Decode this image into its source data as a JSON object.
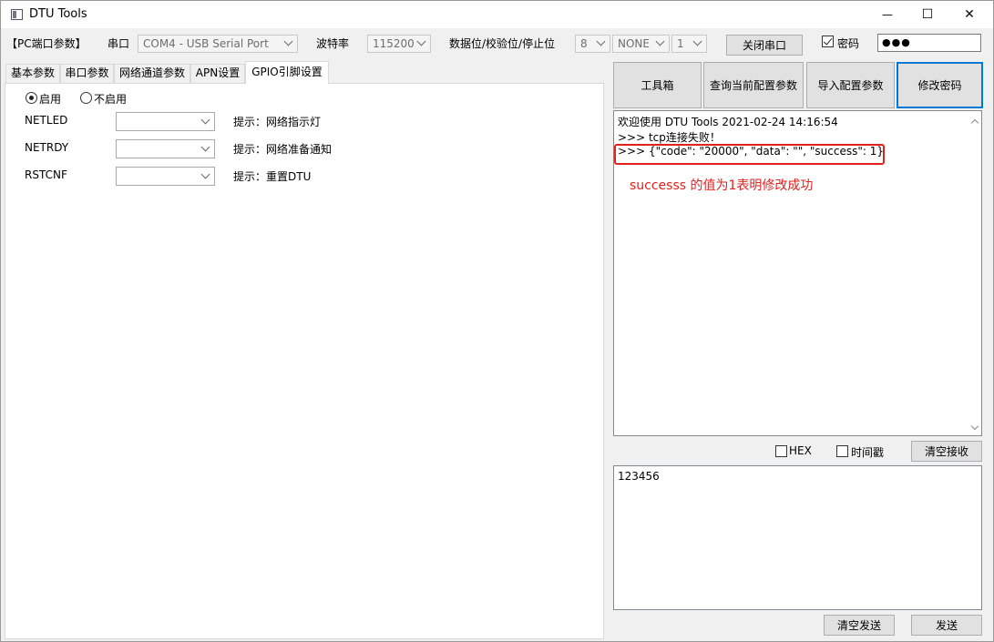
{
  "window": {
    "title": "DTU Tools",
    "minimize_glyph": "—",
    "maximize_glyph": "☐",
    "close_glyph": "✕"
  },
  "toolbar": {
    "pc_port_label": "【PC端口参数】",
    "serial_label": "串口",
    "serial_value": "COM4 - USB Serial Port",
    "baud_label": "波特率",
    "baud_value": "115200",
    "frame_label": "数据位/校验位/停止位",
    "data_bits": "8",
    "parity": "NONE",
    "stop_bits": "1",
    "close_port_button": "关闭串口",
    "password_check_label": "密码",
    "password_checked": true,
    "password_value": "●●●"
  },
  "tabs": [
    {
      "label": "基本参数",
      "active": false
    },
    {
      "label": "串口参数",
      "active": false
    },
    {
      "label": "网络通道参数",
      "active": false
    },
    {
      "label": "APN设置",
      "active": false
    },
    {
      "label": "GPIO引脚设置",
      "active": true
    }
  ],
  "gpio": {
    "enable_label": "启用",
    "disable_label": "不启用",
    "enabled": true,
    "rows": [
      {
        "name": "NETLED",
        "value": "",
        "hint": "提示：网络指示灯"
      },
      {
        "name": "NETRDY",
        "value": "",
        "hint": "提示：网络准备通知"
      },
      {
        "name": "RSTCNF",
        "value": "",
        "hint": "提示：重置DTU"
      }
    ]
  },
  "actions": {
    "toolbox": "工具箱",
    "query_config": "查询当前配置参数",
    "import_config": "导入配置参数",
    "change_password": "修改密码"
  },
  "receive_log": {
    "lines": [
      "欢迎使用 DTU Tools 2021-02-24 14:16:54",
      ">>> tcp连接失败！",
      ">>> {\"code\": \"20000\", \"data\": \"\", \"success\": 1}"
    ],
    "annotation": "successs 的值为1表明修改成功",
    "annotation_color": "#e0211d"
  },
  "receive_options": {
    "hex_label": "HEX",
    "hex_checked": false,
    "timestamp_label": "时间戳",
    "timestamp_checked": false,
    "clear_receive": "清空接收"
  },
  "send": {
    "text": "123456",
    "clear_send": "清空发送",
    "send_button": "发送"
  }
}
